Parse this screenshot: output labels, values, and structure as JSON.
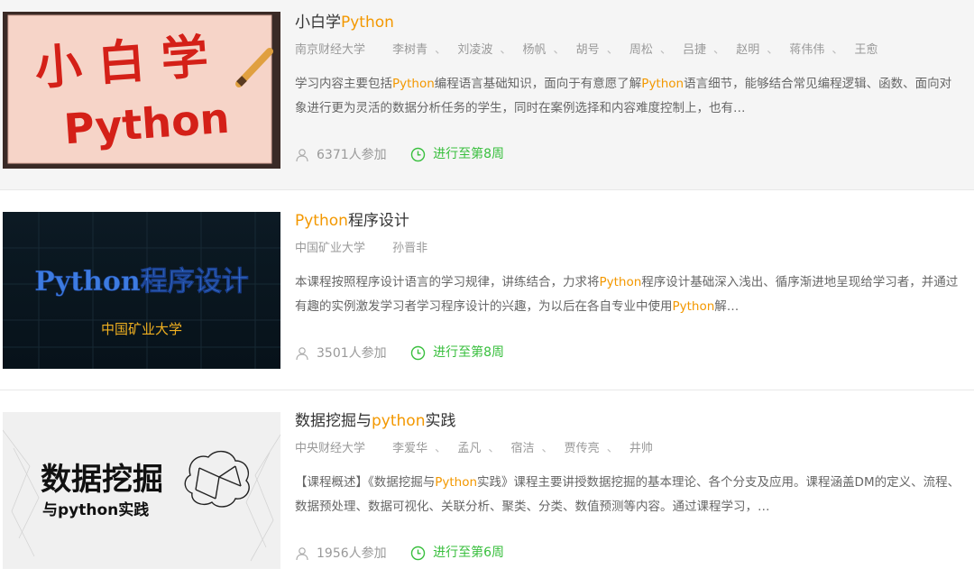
{
  "courses": [
    {
      "title_parts": {
        "a": "小白学",
        "b": "Python",
        "c": ""
      },
      "school": "南京财经大学",
      "teachers": [
        "李树青",
        "刘凌波",
        "杨帆",
        "胡号",
        "周松",
        "吕捷",
        "赵明",
        "蒋伟伟",
        "王愈"
      ],
      "desc_parts": {
        "a": "学习内容主要包括",
        "b": "Python",
        "c": "编程语言基础知识，面向于有意愿了解",
        "d": "Python",
        "e": "语言细节，能够结合常见编程逻辑、函数、面向对象进行更为灵活的数据分析任务的学生，同时在案例选择和内容难度控制上，也有…"
      },
      "count": "6371人参加",
      "progress": "进行至第8周",
      "thumb": {
        "line1": "小 白 学",
        "line2": "Python"
      }
    },
    {
      "title_parts": {
        "a": "",
        "b": "Python",
        "c": "程序设计"
      },
      "school": "中国矿业大学",
      "teachers": [
        "孙晋非"
      ],
      "desc_parts": {
        "a": "本课程按照程序设计语言的学习规律，讲练结合，力求将",
        "b": "Python",
        "c": "程序设计基础深入浅出、循序渐进地呈现给学习者，并通过有趣的实例激发学习者学习程序设计的兴趣，为以后在各自专业中使用",
        "d": "Python",
        "e": "解…"
      },
      "count": "3501人参加",
      "progress": "进行至第8周",
      "thumb": {
        "line1": "Python程序设计",
        "line2": "中国矿业大学"
      }
    },
    {
      "title_parts": {
        "a": "数据挖掘与",
        "b": "python",
        "c": "实践"
      },
      "school": "中央财经大学",
      "teachers": [
        "李爱华",
        "孟凡",
        "宿洁",
        "贾传亮",
        "井帅"
      ],
      "desc_parts": {
        "a": "【课程概述】《数据挖掘与",
        "b": "Python",
        "c": "实践》课程主要讲授数据挖掘的基本理论、各个分支及应用。课程涵盖DM的定义、流程、数据预处理、数据可视化、关联分析、聚类、分类、数值预测等内容。通过课程学习，…",
        "d": "",
        "e": ""
      },
      "count": "1956人参加",
      "progress": "进行至第6周",
      "thumb": {
        "line1": "数据挖掘",
        "line2": "与python实践"
      }
    }
  ],
  "colors": {
    "highlight": "#f39800",
    "progress": "#39bf3e",
    "muted": "#999999"
  },
  "icons": {
    "count": "user-icon",
    "progress": "clock-icon"
  }
}
